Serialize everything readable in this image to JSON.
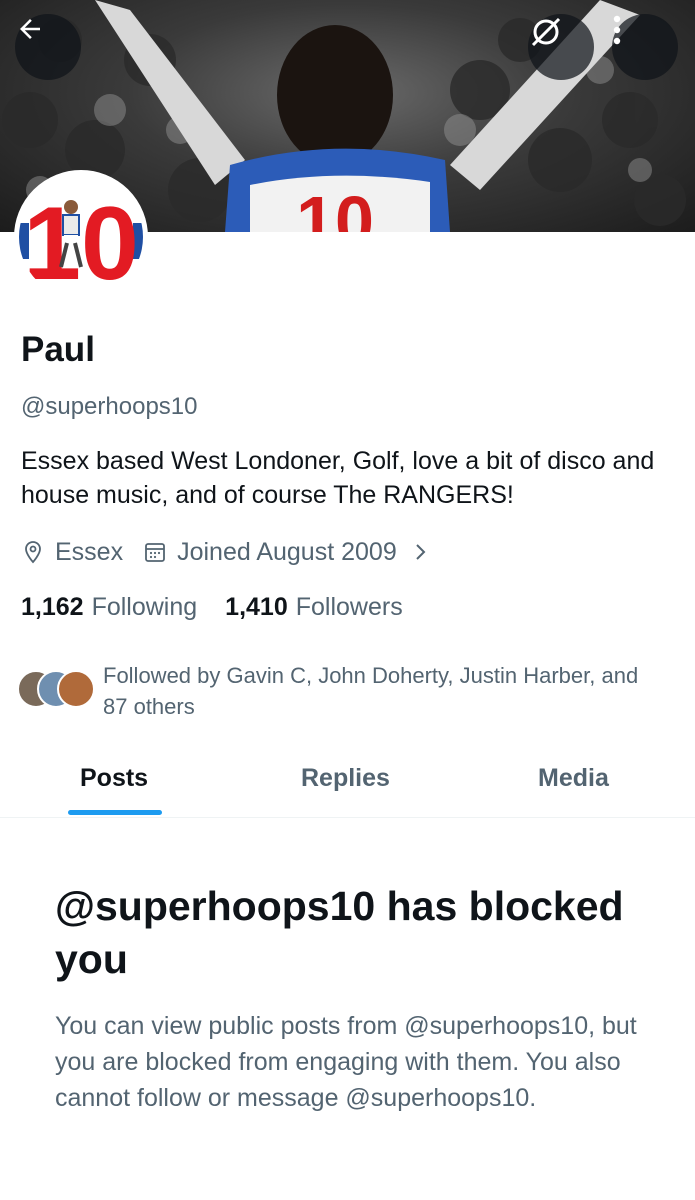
{
  "header": {
    "back_icon": "arrow-left-icon",
    "grok_icon": "grok-icon",
    "more_icon": "more-vertical-icon"
  },
  "profile": {
    "name": "Paul",
    "handle": "@superhoops10",
    "avatar_text": "10",
    "bio": "Essex based West Londoner, Golf, love a bit of disco and house music, and of course The RANGERS!",
    "location": "Essex",
    "joined": "Joined August 2009",
    "following_count": "1,162",
    "following_label": "Following",
    "followers_count": "1,410",
    "followers_label": "Followers",
    "followed_by": "Followed by Gavin C, John Doherty, Justin Harber, and 87 others"
  },
  "tabs": [
    {
      "label": "Posts",
      "active": true
    },
    {
      "label": "Replies",
      "active": false
    },
    {
      "label": "Media",
      "active": false
    }
  ],
  "blocked": {
    "title": "@superhoops10 has blocked you",
    "body": "You can view public posts from @superhoops10, but you are blocked from engaging with them. You also cannot follow or message @superhoops10."
  },
  "colors": {
    "accent": "#1d9bf0",
    "text_primary": "#0f1419",
    "text_secondary": "#536471",
    "avatar_red": "#e31b23",
    "avatar_blue": "#1f4fa3"
  }
}
